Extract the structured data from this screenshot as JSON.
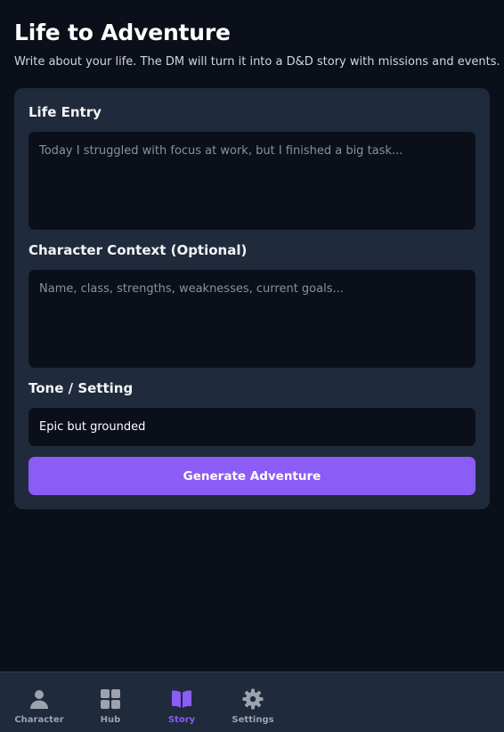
{
  "page": {
    "title": "Life to Adventure",
    "subtitle": "Write about your life. The DM will turn it into a D&D story with missions and events."
  },
  "form": {
    "life_entry": {
      "label": "Life Entry",
      "placeholder": "Today I struggled with focus at work, but I finished a big task...",
      "value": ""
    },
    "character_context": {
      "label": "Character Context (Optional)",
      "placeholder": "Name, class, strengths, weaknesses, current goals...",
      "value": ""
    },
    "tone_setting": {
      "label": "Tone / Setting",
      "value": "Epic but grounded"
    },
    "submit_label": "Generate Adventure"
  },
  "nav": {
    "items": [
      {
        "label": "Character",
        "icon": "person-icon",
        "active": false
      },
      {
        "label": "Hub",
        "icon": "grid-icon",
        "active": false
      },
      {
        "label": "Story",
        "icon": "book-icon",
        "active": true
      },
      {
        "label": "Settings",
        "icon": "gear-icon",
        "active": false
      }
    ]
  },
  "colors": {
    "background": "#0b0f19",
    "card": "#1f2a3c",
    "accent": "#8b5cf6",
    "muted_text": "#9ca3af"
  }
}
